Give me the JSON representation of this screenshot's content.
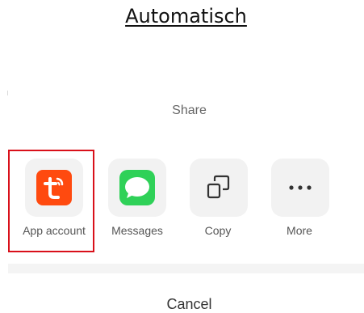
{
  "page": {
    "heading": "Automatisch"
  },
  "share_sheet": {
    "title": "Share",
    "apps": [
      {
        "label": "App account",
        "icon": "tuya-t-icon",
        "color": "#ff4a0f",
        "highlighted": true
      },
      {
        "label": "Messages",
        "icon": "speech-bubble-icon",
        "color": "#2fd158"
      },
      {
        "label": "Copy",
        "icon": "copy-icon"
      },
      {
        "label": "More",
        "icon": "more-dots-icon"
      }
    ],
    "cancel_label": "Cancel"
  },
  "colors": {
    "highlight_border": "#d9101a",
    "tile_background": "#f2f2f2"
  }
}
